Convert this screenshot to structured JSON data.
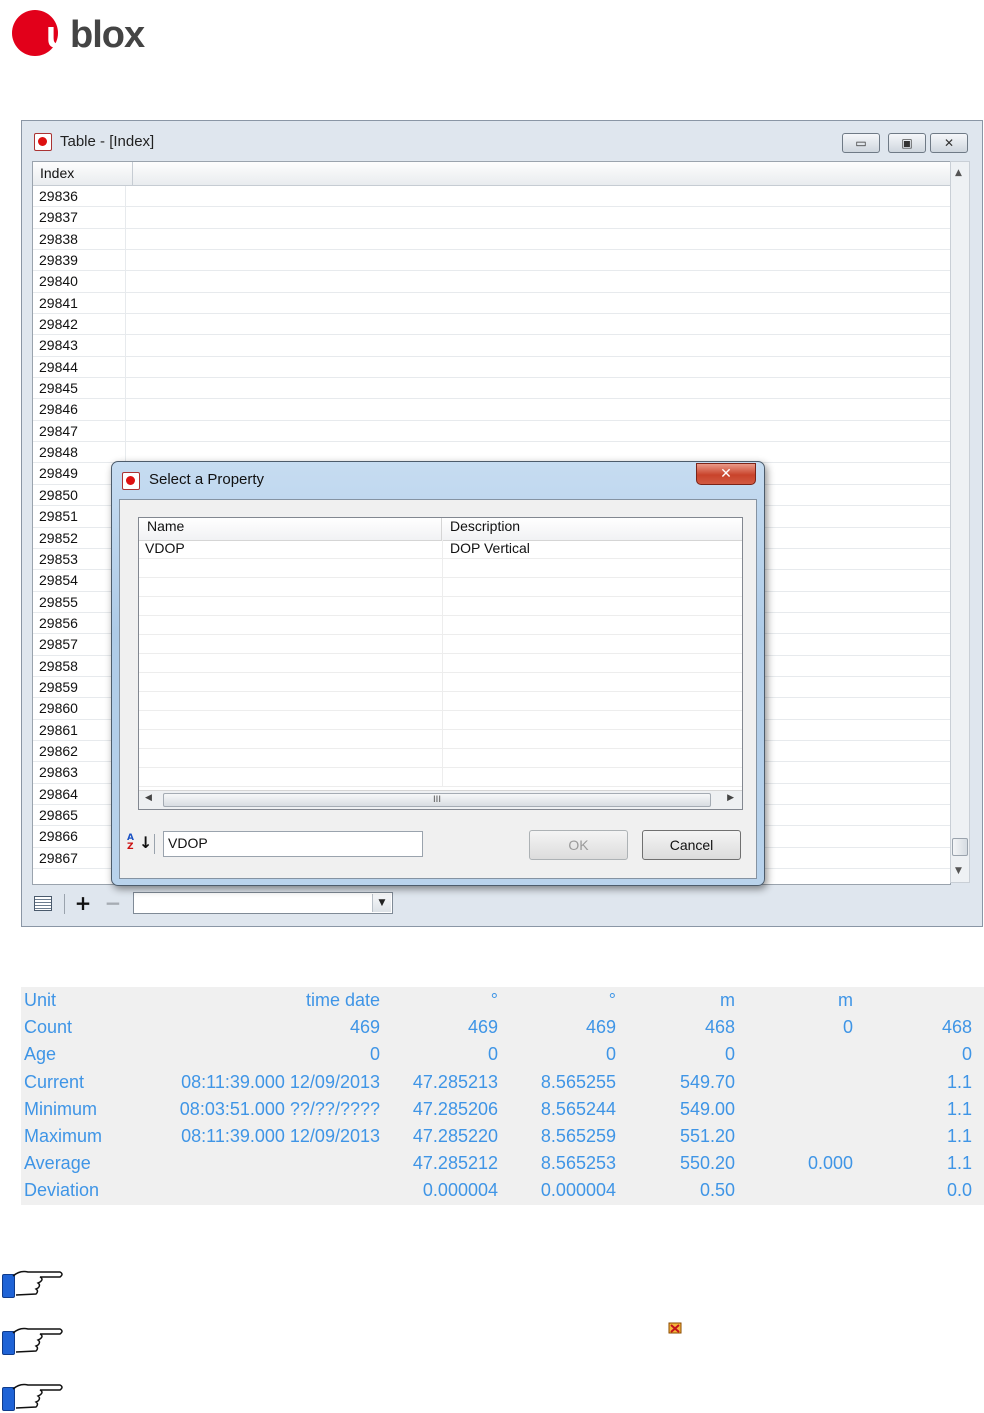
{
  "logo": {
    "u": "u",
    "rest": "blox"
  },
  "window": {
    "title": "Table - [Index]",
    "buttons": {
      "minimize": "▭",
      "maximize": "▣",
      "close": "✕"
    },
    "grid": {
      "header": "Index",
      "rows": [
        "29836",
        "29837",
        "29838",
        "29839",
        "29840",
        "29841",
        "29842",
        "29843",
        "29844",
        "29845",
        "29846",
        "29847",
        "29848",
        "29849",
        "29850",
        "29851",
        "29852",
        "29853",
        "29854",
        "29855",
        "29856",
        "29857",
        "29858",
        "29859",
        "29860",
        "29861",
        "29862",
        "29863",
        "29864",
        "29865",
        "29866",
        "29867"
      ]
    },
    "toolbar": {
      "add": "+",
      "remove": "−",
      "combo_value": ""
    }
  },
  "dialog": {
    "title": "Select a Property",
    "close_label": "✕",
    "columns": {
      "name": "Name",
      "description": "Description"
    },
    "rows": [
      {
        "name": "VDOP",
        "description": "DOP Vertical"
      }
    ],
    "scroll_grip": "III",
    "input_value": "VDOP",
    "ok_label": "OK",
    "cancel_label": "Cancel"
  },
  "stats": {
    "rows": [
      {
        "label": "Unit",
        "c1": "time date",
        "c2": "°",
        "c3": "°",
        "c4": "m",
        "c5": "m",
        "c6": ""
      },
      {
        "label": "Count",
        "c1": "469",
        "c2": "469",
        "c3": "469",
        "c4": "468",
        "c5": "0",
        "c6": "468"
      },
      {
        "label": "Age",
        "c1": "0",
        "c2": "0",
        "c3": "0",
        "c4": "0",
        "c5": "",
        "c6": "0"
      },
      {
        "label": "Current",
        "c1": "08:11:39.000 12/09/2013",
        "c2": "47.285213",
        "c3": "8.565255",
        "c4": "549.70",
        "c5": "",
        "c6": "1.1"
      },
      {
        "label": "Minimum",
        "c1": "08:03:51.000 ??/??/????",
        "c2": "47.285206",
        "c3": "8.565244",
        "c4": "549.00",
        "c5": "",
        "c6": "1.1"
      },
      {
        "label": "Maximum",
        "c1": "08:11:39.000 12/09/2013",
        "c2": "47.285220",
        "c3": "8.565259",
        "c4": "551.20",
        "c5": "",
        "c6": "1.1"
      },
      {
        "label": "Average",
        "c1": "",
        "c2": "47.285212",
        "c3": "8.565253",
        "c4": "550.20",
        "c5": "0.000",
        "c6": "1.1"
      },
      {
        "label": "Deviation",
        "c1": "",
        "c2": "0.000004",
        "c3": "0.000004",
        "c4": "0.50",
        "c5": "",
        "c6": "0.0"
      }
    ]
  },
  "notes": {
    "icon": "pointing-hand-icon",
    "count": 3
  }
}
